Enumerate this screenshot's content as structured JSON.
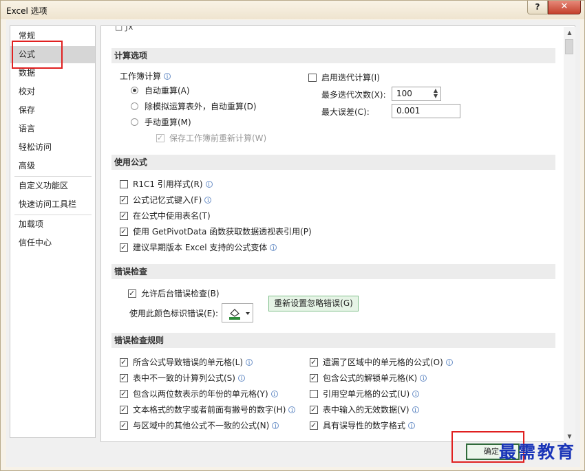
{
  "window": {
    "title": "Excel 选项",
    "help": "?",
    "close": "✕"
  },
  "sidebar": {
    "items": [
      {
        "label": "常规"
      },
      {
        "label": "公式"
      },
      {
        "label": "数据"
      },
      {
        "label": "校对"
      },
      {
        "label": "保存"
      },
      {
        "label": "语言"
      },
      {
        "label": "轻松访问"
      },
      {
        "label": "高级"
      },
      {
        "label": "自定义功能区"
      },
      {
        "label": "快速访问工具栏"
      },
      {
        "label": "加载项"
      },
      {
        "label": "信任中心"
      }
    ],
    "selected": "公式"
  },
  "partial_header": "□ ƒx",
  "calc": {
    "section": "计算选项",
    "workbook_calc_label": "工作簿计算",
    "radio_auto": "自动重算(A)",
    "radio_auto_except": "除模拟运算表外，自动重算(D)",
    "radio_manual": "手动重算(M)",
    "recalc_before_save": "保存工作簿前重新计算(W)",
    "iterative_label": "启用迭代计算(I)",
    "max_iterations_label": "最多迭代次数(X):",
    "max_iterations_value": "100",
    "max_change_label": "最大误差(C):",
    "max_change_value": "0.001"
  },
  "working": {
    "section": "使用公式",
    "r1c1": "R1C1 引用样式(R)",
    "autocomplete": "公式记忆式键入(F)",
    "table_names": "在公式中使用表名(T)",
    "getpivot": "使用 GetPivotData 函数获取数据透视表引用(P)",
    "suggest_compat": "建议早期版本 Excel 支持的公式变体"
  },
  "error_check": {
    "section": "错误检查",
    "enable_bg": "允许后台错误检查(B)",
    "color_label": "使用此颜色标识错误(E):",
    "reset_button": "重新设置忽略错误(G)",
    "fill_color": "#2e8b3a"
  },
  "rules": {
    "section": "错误检查规则",
    "left": [
      {
        "label": "所含公式导致错误的单元格(L)",
        "checked": true
      },
      {
        "label": "表中不一致的计算列公式(S)",
        "checked": true
      },
      {
        "label": "包含以两位数表示的年份的单元格(Y)",
        "checked": true
      },
      {
        "label": "文本格式的数字或者前面有撇号的数字(H)",
        "checked": true
      },
      {
        "label": "与区域中的其他公式不一致的公式(N)",
        "checked": true
      }
    ],
    "right": [
      {
        "label": "遗漏了区域中的单元格的公式(O)",
        "checked": true
      },
      {
        "label": "包含公式的解锁单元格(K)",
        "checked": true
      },
      {
        "label": "引用空单元格的公式(U)",
        "checked": false
      },
      {
        "label": "表中输入的无效数据(V)",
        "checked": true
      },
      {
        "label": "具有误导性的数字格式",
        "checked": true
      }
    ]
  },
  "footer": {
    "ok": "确定"
  },
  "watermark": "最需教育",
  "colors": {
    "highlight_red": "#e02020",
    "watermark_blue": "#1a35b8",
    "section_bg": "#ececec"
  }
}
